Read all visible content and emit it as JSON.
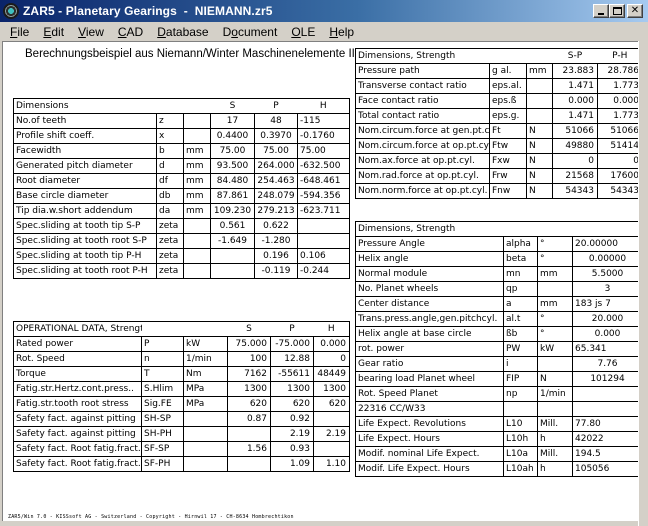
{
  "window": {
    "title": "ZAR5 - Planetary Gearings  -  NIEMANN.zr5",
    "buttons": {
      "minimize": "_",
      "maximize": "□",
      "close": "✕"
    }
  },
  "menu": [
    {
      "label": "File",
      "accel": "F",
      "rest": "ile"
    },
    {
      "label": "Edit",
      "accel": "E",
      "rest": "dit"
    },
    {
      "label": "View",
      "accel": "V",
      "rest": "iew"
    },
    {
      "label": "CAD",
      "accel": "C",
      "rest": "AD"
    },
    {
      "label": "Database",
      "accel": "D",
      "rest": "atabase"
    },
    {
      "label": "Document",
      "pre": "D",
      "accel": "o",
      "rest": "cument"
    },
    {
      "label": "OLE",
      "accel": "O",
      "rest": "LE"
    },
    {
      "label": "Help",
      "accel": "H",
      "rest": "elp"
    }
  ],
  "document_title": "Berechnungsbeispiel aus Niemann/Winter Maschinenelemente II",
  "dimensions_table": {
    "header": {
      "label": "Dimensions",
      "cols": [
        "S",
        "P",
        "H"
      ]
    },
    "rows": [
      {
        "label": "No.of teeth",
        "sym": "z",
        "unit": "",
        "S": "17",
        "P": "48",
        "H": "-115"
      },
      {
        "label": "Profile shift coeff.",
        "sym": "x",
        "unit": "",
        "S": "0.4400",
        "P": "0.3970",
        "H": "-0.1760"
      },
      {
        "label": "Facewidth",
        "sym": "b",
        "unit": "mm",
        "S": "75.00",
        "P": "75.00",
        "H": "75.00"
      },
      {
        "label": "Generated pitch diameter",
        "sym": "d",
        "unit": "mm",
        "S": "93.500",
        "P": "264.000",
        "H": "-632.500"
      },
      {
        "label": "Root diameter",
        "sym": "df",
        "unit": "mm",
        "S": "84.480",
        "P": "254.463",
        "H": "-648.461"
      },
      {
        "label": "Base circle diameter",
        "sym": "db",
        "unit": "mm",
        "S": "87.861",
        "P": "248.079",
        "H": "-594.356"
      },
      {
        "label": "Tip dia.w.short addendum",
        "sym": "da",
        "unit": "mm",
        "S": "109.230",
        "P": "279.213",
        "H": "-623.711"
      },
      {
        "label": "Spec.sliding at tooth tip S-P",
        "sym": "zeta",
        "unit": "",
        "S": "0.561",
        "P": "0.622",
        "H": ""
      },
      {
        "label": "Spec.sliding at tooth root S-P",
        "sym": "zeta",
        "unit": "",
        "S": "-1.649",
        "P": "-1.280",
        "H": ""
      },
      {
        "label": "Spec.sliding at tooth tip P-H",
        "sym": "zeta",
        "unit": "",
        "S": "",
        "P": "0.196",
        "H": "0.106"
      },
      {
        "label": "Spec.sliding at tooth root P-H",
        "sym": "zeta",
        "unit": "",
        "S": "",
        "P": "-0.119",
        "H": "-0.244"
      }
    ]
  },
  "operational_table": {
    "header": {
      "label": "OPERATIONAL DATA, Strength",
      "cols": [
        "S",
        "P",
        "H"
      ]
    },
    "rows": [
      {
        "label": "Rated power",
        "sym": "P",
        "unit": "kW",
        "S": "75.000",
        "P": "-75.000",
        "H": "0.000"
      },
      {
        "label": "Rot. Speed",
        "sym": "n",
        "unit": "1/min",
        "S": "100",
        "P": "12.88",
        "H": "0"
      },
      {
        "label": "Torque",
        "sym": "T",
        "unit": "Nm",
        "S": "7162",
        "P": "-55611",
        "H": "48449"
      },
      {
        "label": "Fatig.str.Hertz.cont.press..",
        "sym": "S.Hlim",
        "unit": "MPa",
        "S": "1300",
        "P": "1300",
        "H": "1300"
      },
      {
        "label": "Fatig.str.tooth root stress",
        "sym": "Sig.FE",
        "unit": "MPa",
        "S": "620",
        "P": "620",
        "H": "620"
      },
      {
        "label": "Safety fact. against pitting",
        "sym": "SH-SP",
        "unit": "",
        "S": "0.87",
        "P": "0.92",
        "H": ""
      },
      {
        "label": "Safety fact. against pitting",
        "sym": "SH-PH",
        "unit": "",
        "S": "",
        "P": "2.19",
        "H": "2.19"
      },
      {
        "label": "Safety fact. Root fatig.fract.",
        "sym": "SF-SP",
        "unit": "",
        "S": "1.56",
        "P": "0.93",
        "H": ""
      },
      {
        "label": "Safety fact. Root fatig.fract.",
        "sym": "SF-PH",
        "unit": "",
        "S": "",
        "P": "1.09",
        "H": "1.10"
      }
    ]
  },
  "strength_pair_table": {
    "header": {
      "label": "Dimensions, Strength",
      "cols": [
        "S-P",
        "P-H"
      ]
    },
    "rows": [
      {
        "label": "Pressure path",
        "sym": "g al.",
        "unit": "mm",
        "SP": "23.883",
        "PH": "28.786"
      },
      {
        "label": "Transverse contact ratio",
        "sym": "eps.al.",
        "unit": "",
        "SP": "1.471",
        "PH": "1.773"
      },
      {
        "label": "Face contact ratio",
        "sym": "eps.ß",
        "unit": "",
        "SP": "0.000",
        "PH": "0.000"
      },
      {
        "label": "Total contact ratio",
        "sym": "eps.g.",
        "unit": "",
        "SP": "1.471",
        "PH": "1.773"
      },
      {
        "label": "Nom.circum.force at gen.pt.cyl",
        "sym": "Ft",
        "unit": "N",
        "SP": "51066",
        "PH": "51066"
      },
      {
        "label": "Nom.circum.force at op.pt.cyl.",
        "sym": "Ftw",
        "unit": "N",
        "SP": "49880",
        "PH": "51414"
      },
      {
        "label": "Nom.ax.force at op.pt.cyl.",
        "sym": "Fxw",
        "unit": "N",
        "SP": "0",
        "PH": "0"
      },
      {
        "label": "Nom.rad.force at op.pt.cyl.",
        "sym": "Frw",
        "unit": "N",
        "SP": "21568",
        "PH": "17600"
      },
      {
        "label": "Nom.norm.force at op.pt.cyl.",
        "sym": "Fnw",
        "unit": "N",
        "SP": "54343",
        "PH": "54343"
      }
    ]
  },
  "strength_general_table": {
    "header": {
      "label": "Dimensions, Strength"
    },
    "rows": [
      {
        "label": "Pressure Angle",
        "sym": "alpha",
        "unit": "°",
        "val": "20.00000",
        "align": "l"
      },
      {
        "label": "Helix angle",
        "sym": "beta",
        "unit": "°",
        "val": "0.00000",
        "align": "c"
      },
      {
        "label": "Normal module",
        "sym": "mn",
        "unit": "mm",
        "val": "5.5000",
        "align": "c"
      },
      {
        "label": "No. Planet wheels",
        "sym": "qp",
        "unit": "",
        "val": "3",
        "align": "c"
      },
      {
        "label": "Center distance",
        "sym": "a",
        "unit": "mm",
        "val": "183 js 7",
        "align": "l"
      },
      {
        "label": "Trans.press.angle,gen.pitchcyl.",
        "sym": "al.t",
        "unit": "°",
        "val": "20.000",
        "align": "c"
      },
      {
        "label": "Helix angle at base circle",
        "sym": "ßb",
        "unit": "°",
        "val": "0.000",
        "align": "c"
      },
      {
        "label": "rot. power",
        "sym": "PW",
        "unit": "kW",
        "val": "65.341",
        "align": "l"
      },
      {
        "label": "Gear ratio",
        "sym": "i",
        "unit": "",
        "val": "7.76",
        "align": "c"
      },
      {
        "label": "bearing load Planet wheel",
        "sym": "FIP",
        "unit": "N",
        "val": "101294",
        "align": "c"
      },
      {
        "label": "Rot. Speed Planet",
        "sym": "np",
        "unit": "1/min",
        "val": "",
        "align": "l"
      },
      {
        "label": "22316 CC/W33",
        "sym": "",
        "unit": "",
        "val": "",
        "align": "l"
      },
      {
        "label": "Life Expect. Revolutions",
        "sym": "L10",
        "unit": "Mill.",
        "val": "77.80",
        "align": "l"
      },
      {
        "label": "Life Expect. Hours",
        "sym": "L10h",
        "unit": "h",
        "val": "42022",
        "align": "l"
      },
      {
        "label": "Modif. nominal Life Expect.",
        "sym": "L10a",
        "unit": "Mill.",
        "val": "194.5",
        "align": "l"
      },
      {
        "label": "Modif. Life Expect. Hours",
        "sym": "L10ah",
        "unit": "h",
        "val": "105056",
        "align": "l"
      }
    ]
  },
  "footer_text": "ZAR5/Win 7.0 - KISSsoft AG - Switzerland - Copyright - Hirnwil 17 - CH-8634 Hombrechtikon"
}
